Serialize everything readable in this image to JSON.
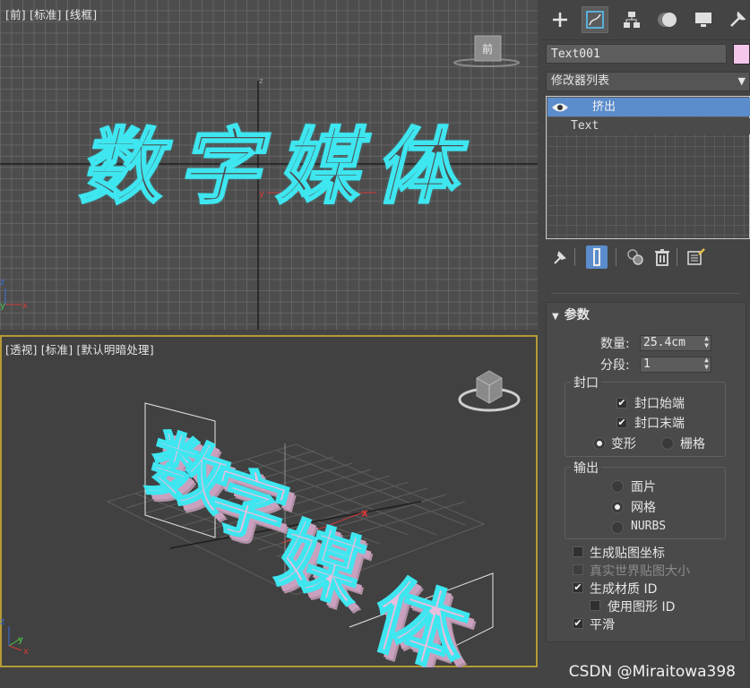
{
  "viewport_front": {
    "label": "[前] [标准] [线框]",
    "text": "数字媒体",
    "viewcube_label": "前"
  },
  "viewport_persp": {
    "label": "[透视] [标准] [默认明暗处理]",
    "chars": [
      "数",
      "字",
      "媒",
      "体"
    ]
  },
  "panel": {
    "tabs": [
      "create-icon",
      "modify-icon",
      "hierarchy-icon",
      "motion-icon",
      "display-icon",
      "utilities-icon"
    ],
    "object_name": "Text001",
    "object_color": "#f3c6ea",
    "modifier_list": "修改器列表",
    "stack": {
      "selected": "挤出",
      "base": "Text"
    },
    "rollout": {
      "title": "参数",
      "amount_label": "数量:",
      "amount_value": "25.4cm",
      "segments_label": "分段:",
      "segments_value": "1",
      "capping": {
        "title": "封口",
        "cap_start": "封口始端",
        "cap_end": "封口末端",
        "morph": "变形",
        "grid": "栅格"
      },
      "output": {
        "title": "输出",
        "patch": "面片",
        "mesh": "网格",
        "nurbs": "NURBS"
      },
      "gen_mapping": "生成贴图坐标",
      "real_world": "真实世界贴图大小",
      "gen_matid": "生成材质 ID",
      "use_shape_ids": "使用图形 ID",
      "smooth": "平滑"
    }
  },
  "watermark": "CSDN @Miraitowa398",
  "colors": {
    "selection_blue": "#5b8ccc",
    "outline_cyan": "#3ee6f0",
    "text_pink": "#e7bfdc",
    "active_border": "#b49a37"
  }
}
